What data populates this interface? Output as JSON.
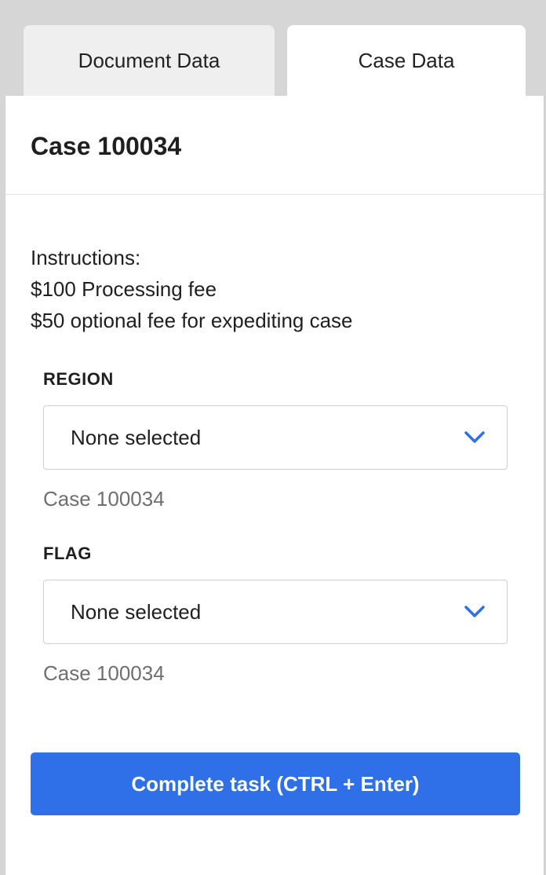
{
  "tabs": [
    {
      "label": "Document Data",
      "active": false
    },
    {
      "label": "Case Data",
      "active": true
    }
  ],
  "case": {
    "title": "Case 100034"
  },
  "instructions": {
    "heading": "Instructions:",
    "lines": [
      "$100 Processing fee",
      "$50 optional fee for expediting case"
    ]
  },
  "fields": {
    "region": {
      "label": "REGION",
      "value": "None selected",
      "helper": "Case 100034"
    },
    "flag": {
      "label": "FLAG",
      "value": "None selected",
      "helper": "Case 100034"
    }
  },
  "actions": {
    "complete_label": "Complete task (CTRL + Enter)"
  },
  "icons": {
    "select_chevron": "chevron-down-icon"
  },
  "colors": {
    "accent": "#2f6fe8",
    "chevron": "#2f6fe8",
    "background": "#d6d6d6",
    "inactive_tab": "#efefef"
  }
}
